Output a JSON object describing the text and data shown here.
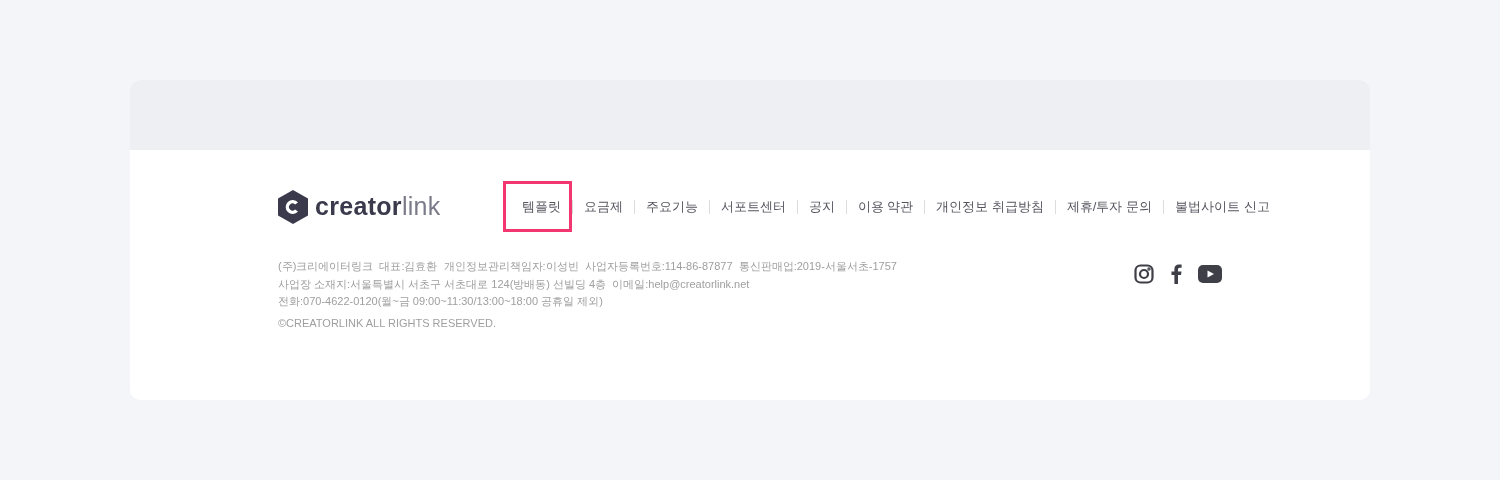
{
  "logo": {
    "text_bold": "creator",
    "text_light": "link"
  },
  "nav": [
    {
      "label": "템플릿",
      "highlighted": true
    },
    {
      "label": "요금제",
      "highlighted": false
    },
    {
      "label": "주요기능",
      "highlighted": false
    },
    {
      "label": "서포트센터",
      "highlighted": false
    },
    {
      "label": "공지",
      "highlighted": false
    },
    {
      "label": "이용 약관",
      "highlighted": false
    },
    {
      "label": "개인정보 취급방침",
      "highlighted": false
    },
    {
      "label": "제휴/투자 문의",
      "highlighted": false
    },
    {
      "label": "불법사이트 신고",
      "highlighted": false
    }
  ],
  "company_info": [
    "(주)크리에이터링크  대표:김효환  개인정보관리책임자:이성빈  사업자등록번호:114-86-87877  통신판매업:2019-서울서초-1757",
    "사업장 소재지:서울특별시 서초구 서초대로 124(방배동) 선빌딩 4층  이메일:help@creatorlink.net",
    "전화:070-4622-0120(월~금 09:00~11:30/13:00~18:00 공휴일 제외)"
  ],
  "copyright": "©CREATORLINK ALL RIGHTS RESERVED.",
  "social": [
    {
      "kind": "instagram"
    },
    {
      "kind": "facebook"
    },
    {
      "kind": "youtube"
    }
  ]
}
